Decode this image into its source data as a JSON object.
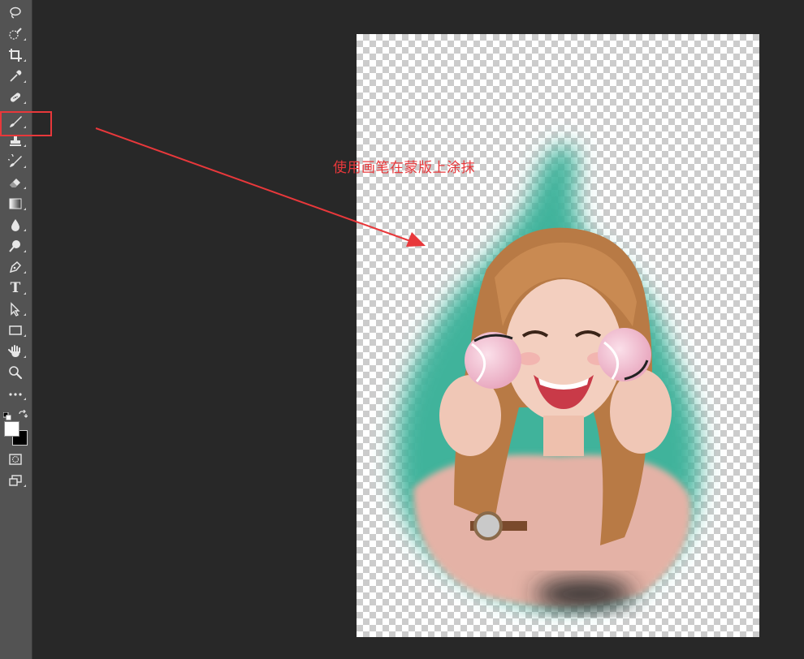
{
  "annotation": {
    "text": "使用画笔在蒙版上涂抹",
    "color": "#e8383b"
  },
  "toolbar": {
    "tools": [
      {
        "icon": "lasso-icon"
      },
      {
        "icon": "quick-selection-icon"
      },
      {
        "icon": "crop-icon"
      },
      {
        "icon": "eyedropper-icon"
      },
      {
        "icon": "healing-brush-icon"
      },
      {
        "icon": "brush-icon",
        "selected": true
      },
      {
        "icon": "clone-stamp-icon"
      },
      {
        "icon": "history-brush-icon"
      },
      {
        "icon": "eraser-icon"
      },
      {
        "icon": "gradient-icon"
      },
      {
        "icon": "blur-icon"
      },
      {
        "icon": "dodge-icon"
      },
      {
        "icon": "pen-icon"
      },
      {
        "icon": "type-icon"
      },
      {
        "icon": "path-selection-icon"
      },
      {
        "icon": "rectangle-icon"
      },
      {
        "icon": "hand-icon"
      },
      {
        "icon": "zoom-icon"
      },
      {
        "icon": "more-tools-icon"
      }
    ],
    "type_tool_glyph": "T",
    "foreground_color": "#ffffff",
    "background_color": "#000000"
  },
  "canvas": {
    "transparency": "checkerboard",
    "mask_color": "#3fb39b"
  }
}
